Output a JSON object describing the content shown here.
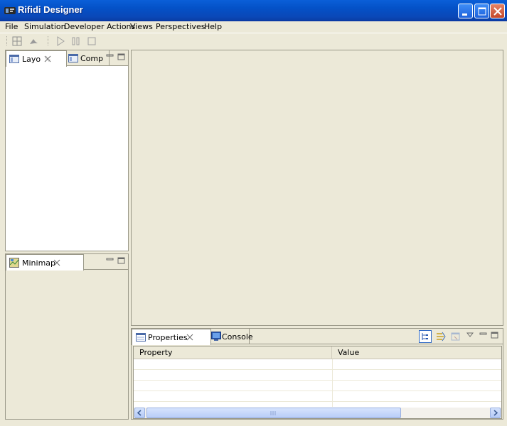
{
  "window": {
    "title": "Rifidi Designer",
    "controls": [
      "minimize-icon",
      "maximize-icon",
      "close-icon"
    ]
  },
  "menubar": {
    "items": [
      {
        "label": "File"
      },
      {
        "label": "Simulation"
      },
      {
        "label": "Developer Actions"
      },
      {
        "label": "Views"
      },
      {
        "label": "Perspectives"
      },
      {
        "label": "Help"
      }
    ]
  },
  "toolbar": {
    "icons": [
      "grid-layout-icon",
      "pointer-icon",
      "play-icon",
      "pause-icon",
      "stop-icon"
    ]
  },
  "layout_panel": {
    "tabs": [
      {
        "label": "Layo",
        "icon": "layout-view-icon",
        "active": true
      },
      {
        "label": "Comp",
        "icon": "component-view-icon",
        "active": false
      }
    ]
  },
  "minimap_panel": {
    "tabs": [
      {
        "label": "Minimap",
        "icon": "minimap-icon",
        "active": true
      }
    ]
  },
  "properties_panel": {
    "tabs": [
      {
        "label": "Properties",
        "icon": "properties-icon",
        "active": true
      },
      {
        "label": "Console",
        "icon": "console-icon",
        "active": false
      }
    ],
    "columns": [
      "Property",
      "Value"
    ]
  },
  "colors": {
    "titlebar": "#0451c7",
    "chrome": "#ece9d8",
    "panel_border": "#9a9888",
    "scrollbar": "#c1d3fb"
  }
}
